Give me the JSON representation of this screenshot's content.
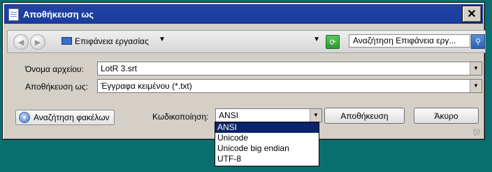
{
  "window": {
    "title": "Αποθήκευση ως"
  },
  "nav": {
    "location": "Επιφάνεια εργασίας",
    "search_placeholder": "Αναζήτηση Επιφάνεια εργ..."
  },
  "form": {
    "filename_label": "Όνομα αρχείου:",
    "filename_value": "LotR 3.srt",
    "savetype_label": "Αποθήκευση ως:",
    "savetype_value": "Έγγραφα κειμένου (*.txt)"
  },
  "footer": {
    "browse_label": "Αναζήτηση φακέλων",
    "encoding_label": "Κωδικοποίηση:",
    "encoding_value": "ANSI",
    "save_label": "Αποθήκευση",
    "cancel_label": "Άκυρο"
  },
  "encoding_options": [
    "ANSI",
    "Unicode",
    "Unicode big endian",
    "UTF-8"
  ]
}
